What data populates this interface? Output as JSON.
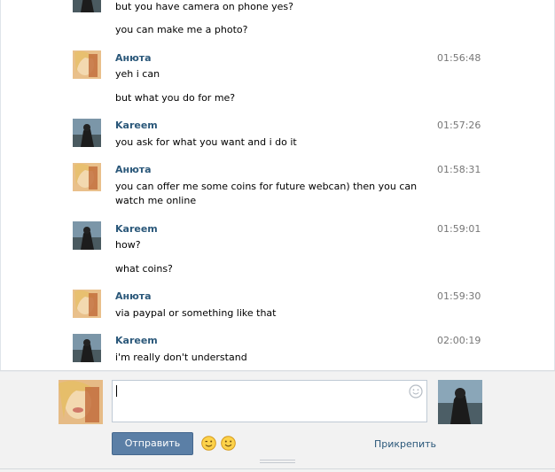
{
  "conversation": [
    {
      "type": "continuation",
      "avatar": "none",
      "lines": [
        "but you have camera on phone yes?",
        "you can make me a photo?"
      ]
    },
    {
      "type": "message",
      "sender": "Анюта",
      "time": "01:56:48",
      "avatar": "anuta-photo",
      "lines": [
        "yeh i can",
        "but what you do for me?"
      ]
    },
    {
      "type": "message",
      "sender": "Kareem",
      "time": "01:57:26",
      "avatar": "kareem-photo",
      "lines": [
        "you ask for what you want and i do it"
      ]
    },
    {
      "type": "message",
      "sender": "Анюта",
      "time": "01:58:31",
      "avatar": "anuta-photo",
      "lines": [
        "you can offer me some coins for future webcan) then you can watch me online"
      ]
    },
    {
      "type": "message",
      "sender": "Kareem",
      "time": "01:59:01",
      "avatar": "kareem-photo",
      "lines": [
        "how?",
        "what coins?"
      ]
    },
    {
      "type": "message",
      "sender": "Анюта",
      "time": "01:59:30",
      "avatar": "anuta-photo",
      "lines": [
        "via paypal or something like that"
      ]
    },
    {
      "type": "message",
      "sender": "Kareem",
      "time": "02:00:19",
      "avatar": "kareem-photo",
      "lines": [
        "i'm really don't understand"
      ]
    }
  ],
  "composer": {
    "input_value": "",
    "send_label": "Отправить",
    "attach_label": "Прикрепить",
    "emoji_icon": "smiley-icon",
    "quick_emoji": [
      "wink-emoji",
      "smile-emoji"
    ]
  },
  "colors": {
    "sender_name": "#2b587a",
    "send_button": "#5b7fa6",
    "composer_bg": "#f2f2f2"
  }
}
